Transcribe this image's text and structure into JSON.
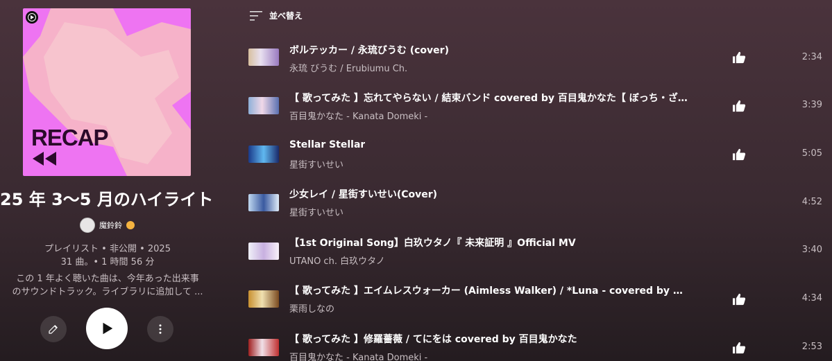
{
  "playlist": {
    "art_text": "RECAP",
    "title": "25 年 3〜5 月のハイライト",
    "owner": "魔鈴鈴",
    "meta_line1": "プレイリスト • 非公開 • 2025",
    "meta_line2": "31 曲。• 1 時間 56 分",
    "description_line1": "この 1 年よく聴いた曲は、今年あった出来事",
    "description_line2": "のサウンドトラック。ライブラリに追加して ...",
    "colors": {
      "art_bg": "#ee74f2",
      "art_text": "#2a0a2a"
    }
  },
  "controls": {
    "edit_icon": "pencil-icon",
    "play_icon": "play-icon",
    "more_icon": "more-vert-icon"
  },
  "sort": {
    "label": "並べ替え",
    "icon": "sort-icon"
  },
  "tracks": [
    {
      "title": "ボルテッカー / 永琉びうむ (cover)",
      "artist": "永琉 びうむ / Erubiumu Ch.",
      "duration": "2:34",
      "liked": true
    },
    {
      "title": "【 歌ってみた 】忘れてやらない / 結束バンド covered by 百目鬼かなた【 ぼっち・ざ…",
      "artist": "百目鬼かなた - Kanata Domeki -",
      "duration": "3:39",
      "liked": true
    },
    {
      "title": "Stellar Stellar",
      "artist": "星街すいせい",
      "duration": "5:05",
      "liked": true
    },
    {
      "title": "少女レイ / 星街すいせい(Cover)",
      "artist": "星街すいせい",
      "duration": "4:52",
      "liked": false
    },
    {
      "title": "【1st Original Song】白玖ウタノ『 未来証明 』Official MV",
      "artist": "UTANO ch. 白玖ウタノ",
      "duration": "3:40",
      "liked": false
    },
    {
      "title": "【 歌ってみた 】エイムレスウォーカー (Aimless Walker) / *Luna  - covered by 栗雨し…",
      "artist": "栗雨しなの",
      "duration": "4:34",
      "liked": true
    },
    {
      "title": "【 歌ってみた 】修羅薔薇 / てにをは covered by 百目鬼かなた",
      "artist": "百目鬼かなた - Kanata Domeki -",
      "duration": "2:53",
      "liked": true
    }
  ]
}
